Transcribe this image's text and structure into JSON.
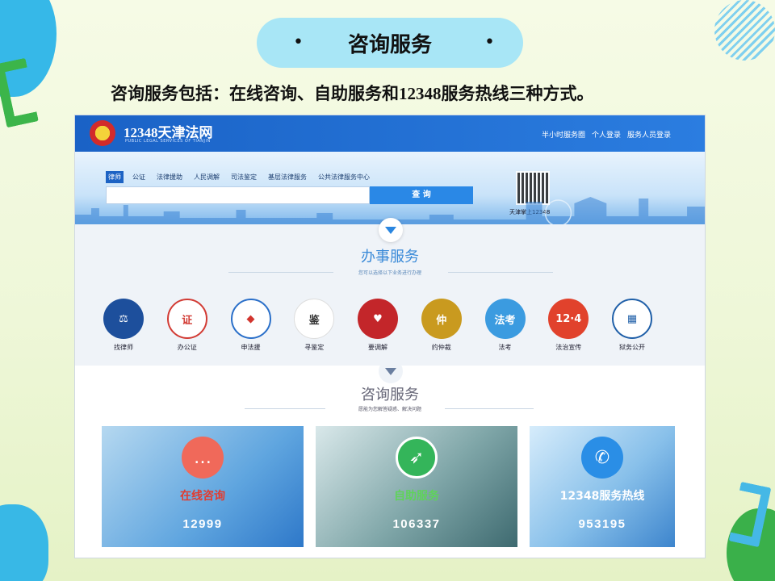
{
  "slide": {
    "title": "咨询服务",
    "bullet_left": "•",
    "bullet_right": "•",
    "intro": "咨询服务包括：在线咨询、自助服务和12348服务热线三种方式。"
  },
  "site": {
    "name": "12348天津法网",
    "name_en": "PUBLIC LEGAL SERVICES OF TIANJIN",
    "top_links": [
      "半小时服务圈",
      "个人登录",
      "服务人员登录"
    ],
    "tabs": [
      "律师",
      "公证",
      "法律援助",
      "人民调解",
      "司法鉴定",
      "基层法律服务",
      "公共法律服务中心"
    ],
    "active_tab": "律师",
    "search_placeholder": "",
    "search_button": "查 询",
    "qr_label": "天津掌上12348"
  },
  "office_section": {
    "title": "办事服务",
    "subtitle": "您可以选择以下业务进行办理",
    "services": [
      {
        "label": "找律师",
        "color": "#1d4f9c"
      },
      {
        "label": "办公证",
        "color": "#d23b34"
      },
      {
        "label": "申法援",
        "color": "#2a6fc9"
      },
      {
        "label": "寻鉴定",
        "color": "#333333"
      },
      {
        "label": "要调解",
        "color": "#c3262a"
      },
      {
        "label": "约仲裁",
        "color": "#c99a1f"
      },
      {
        "label": "法考",
        "color": "#3b9be0"
      },
      {
        "label": "法治宣传",
        "color": "#e1422c"
      },
      {
        "label": "狱务公开",
        "color": "#1f5fa8"
      }
    ]
  },
  "consult_section": {
    "title": "咨询服务",
    "subtitle": "愿能为您解答疑惑、解决问题",
    "cards": [
      {
        "title": "在线咨询",
        "count": "12999",
        "title_color": "#e33b2e",
        "icon_color": "#f0695a"
      },
      {
        "title": "自助服务",
        "count": "106337",
        "title_color": "#5fd35a",
        "icon_color": "#34b55a"
      },
      {
        "title": "12348服务热线",
        "count": "953195",
        "title_color": "#ffffff",
        "icon_color": "#2a8ee6"
      }
    ]
  }
}
